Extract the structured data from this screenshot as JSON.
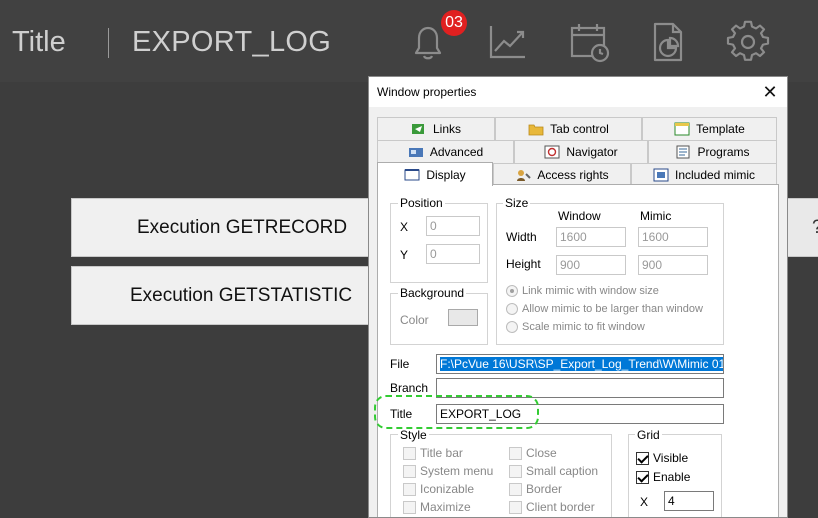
{
  "header": {
    "app_title": "Title",
    "page_name": "EXPORT_LOG",
    "notification_count": "03",
    "icons": [
      "bell-icon",
      "trend-chart-icon",
      "calendar-clock-icon",
      "report-icon",
      "gear-icon"
    ]
  },
  "main": {
    "buttons": [
      "Execution GETRECORD",
      "Execution GETSTATISTIC"
    ],
    "help_label": "?"
  },
  "dialog": {
    "title": "Window properties",
    "close_label": "✕",
    "tabs": {
      "row1": [
        "Links",
        "Tab control",
        "Template"
      ],
      "row2": [
        "Advanced",
        "Navigator",
        "Programs"
      ],
      "row3": [
        "Display",
        "Access rights",
        "Included mimic"
      ]
    },
    "active_tab": "Display",
    "position": {
      "legend": "Position",
      "x_label": "X",
      "x_value": "0",
      "y_label": "Y",
      "y_value": "0"
    },
    "size": {
      "legend": "Size",
      "window_header": "Window",
      "mimic_header": "Mimic",
      "width_label": "Width",
      "height_label": "Height",
      "window_width": "1600",
      "mimic_width": "1600",
      "window_height": "900",
      "mimic_height": "900",
      "options": [
        "Link mimic with window size",
        "Allow mimic to be larger than window",
        "Scale mimic to fit window"
      ],
      "selected_option": 0
    },
    "background": {
      "legend": "Background",
      "color_label": "Color"
    },
    "file": {
      "label": "File",
      "value": "F:\\PcVue 16\\USR\\SP_Export_Log_Trend\\W\\Mimic 01"
    },
    "branch": {
      "label": "Branch",
      "value": ""
    },
    "title_field": {
      "label": "Title",
      "value": "EXPORT_LOG"
    },
    "style": {
      "legend": "Style",
      "left": [
        "Title bar",
        "System menu",
        "Iconizable",
        "Maximize"
      ],
      "right": [
        "Close",
        "Small caption",
        "Border",
        "Client border"
      ]
    },
    "grid": {
      "legend": "Grid",
      "visible_label": "Visible",
      "visible": true,
      "enable_label": "Enable",
      "enable": true,
      "x_label": "X",
      "x_value": "4"
    }
  },
  "colors": {
    "header_bg": "#414141",
    "app_bg": "#3d3d3d",
    "badge": "#e02020",
    "selection": "#0078d7",
    "highlight": "#33cc33"
  }
}
